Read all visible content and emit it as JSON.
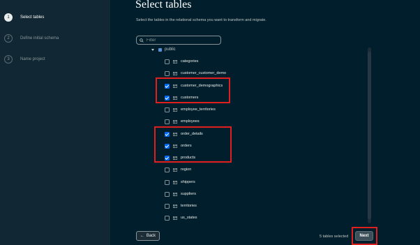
{
  "sidebar": {
    "steps": [
      {
        "number": "1",
        "label": "Select tables",
        "active": true
      },
      {
        "number": "2",
        "label": "Define initial schema",
        "active": false
      },
      {
        "number": "3",
        "label": "Name project",
        "active": false
      }
    ]
  },
  "main": {
    "title": "Select tables",
    "subtitle": "Select the tables in the relational schema you want to transform and migrate.",
    "filter": {
      "placeholder": "Filter",
      "value": ""
    },
    "schema_label": "public",
    "tables": [
      {
        "name": "categories",
        "checked": false
      },
      {
        "name": "customer_customer_demo",
        "checked": false
      },
      {
        "name": "customer_demographics",
        "checked": true
      },
      {
        "name": "customers",
        "checked": true
      },
      {
        "name": "employee_territories",
        "checked": false
      },
      {
        "name": "employees",
        "checked": false
      },
      {
        "name": "order_details",
        "checked": true
      },
      {
        "name": "orders",
        "checked": true
      },
      {
        "name": "products",
        "checked": true
      },
      {
        "name": "region",
        "checked": false
      },
      {
        "name": "shippers",
        "checked": false
      },
      {
        "name": "suppliers",
        "checked": false
      },
      {
        "name": "territories",
        "checked": false
      },
      {
        "name": "us_states",
        "checked": false
      }
    ]
  },
  "footer": {
    "back_label": "Back",
    "selected_count": "5 tables selected",
    "next_label": "Next"
  },
  "colors": {
    "background": "#001e2b",
    "sidebar": "#112733",
    "checkbox_checked": "#016bf8",
    "highlight": "#e0201e"
  }
}
